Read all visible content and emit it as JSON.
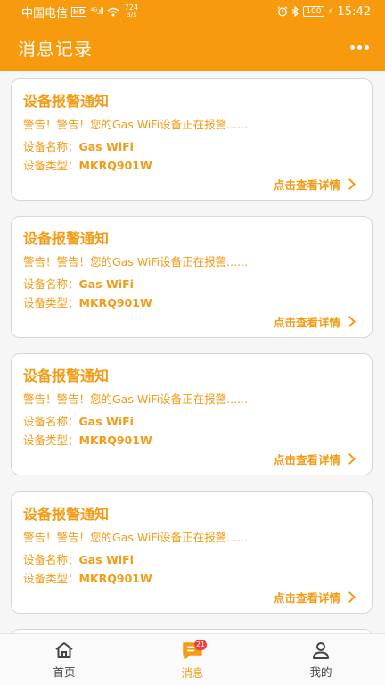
{
  "status_bar": {
    "carrier": "中国电信",
    "hd": "HD",
    "signal": "⁴ᴳ.ıll",
    "net_speed_value": "724",
    "net_speed_unit": "B/s",
    "battery": "100",
    "time": "15:42"
  },
  "app_bar": {
    "title": "消息记录"
  },
  "messages": [
    {
      "title": "设备报警通知",
      "warning": "警告！警告！您的Gas WiFi设备正在报警......",
      "name_label": "设备名称：",
      "name_value": "Gas WiFi",
      "type_label": "设备类型：",
      "type_value": "MKRQ901W",
      "detail_link": "点击查看详情"
    },
    {
      "title": "设备报警通知",
      "warning": "警告！警告！您的Gas WiFi设备正在报警......",
      "name_label": "设备名称：",
      "name_value": "Gas WiFi",
      "type_label": "设备类型：",
      "type_value": "MKRQ901W",
      "detail_link": "点击查看详情"
    },
    {
      "title": "设备报警通知",
      "warning": "警告！警告！您的Gas WiFi设备正在报警......",
      "name_label": "设备名称：",
      "name_value": "Gas WiFi",
      "type_label": "设备类型：",
      "type_value": "MKRQ901W",
      "detail_link": "点击查看详情"
    },
    {
      "title": "设备报警通知",
      "warning": "警告！警告！您的Gas WiFi设备正在报警......",
      "name_label": "设备名称：",
      "name_value": "Gas WiFi",
      "type_label": "设备类型：",
      "type_value": "MKRQ901W",
      "detail_link": "点击查看详情"
    }
  ],
  "tab_bar": {
    "home": "首页",
    "messages": "消息",
    "messages_badge": "21",
    "mine": "我的",
    "active": "messages"
  },
  "colors": {
    "accent": "#f79a0d",
    "text_accent": "#f59a14",
    "badge": "#f03c3c"
  }
}
